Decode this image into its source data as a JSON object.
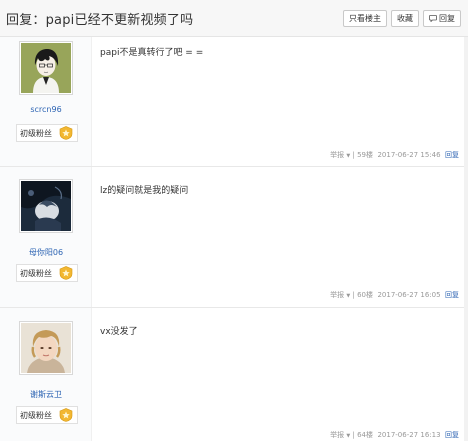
{
  "header": {
    "title": "回复：papi已经不更新视频了吗",
    "only_op_label": "只看楼主",
    "favorite_label": "收藏",
    "reply_label": "回复"
  },
  "posts": [
    {
      "username": "scrcn96",
      "level_label": "初级粉丝",
      "content": "papi不是真转行了吧 = =",
      "report_label": "举报",
      "floor": "59楼",
      "time": "2017-06-27 15:46",
      "reply_label": "回复",
      "avatar_icon": "anime-character-avatar"
    },
    {
      "username": "母你阳06",
      "level_label": "初级粉丝",
      "content": "lz的疑问就是我的疑问",
      "report_label": "举报",
      "floor": "60楼",
      "time": "2017-06-27 16:05",
      "reply_label": "回复",
      "avatar_icon": "dark-photo-avatar"
    },
    {
      "username": "谢斯云卫",
      "level_label": "初级粉丝",
      "content": "vx没发了",
      "report_label": "举报",
      "floor": "64楼",
      "time": "2017-06-27 16:13",
      "reply_label": "回复",
      "avatar_icon": "portrait-photo-avatar"
    }
  ],
  "icons": {
    "level_badge": "star-badge-icon",
    "dropdown": "caret-down-icon",
    "reply": "speech-bubble-icon"
  },
  "colors": {
    "link": "#2d64b3",
    "meta": "#999999",
    "badge": "#f2b731"
  }
}
